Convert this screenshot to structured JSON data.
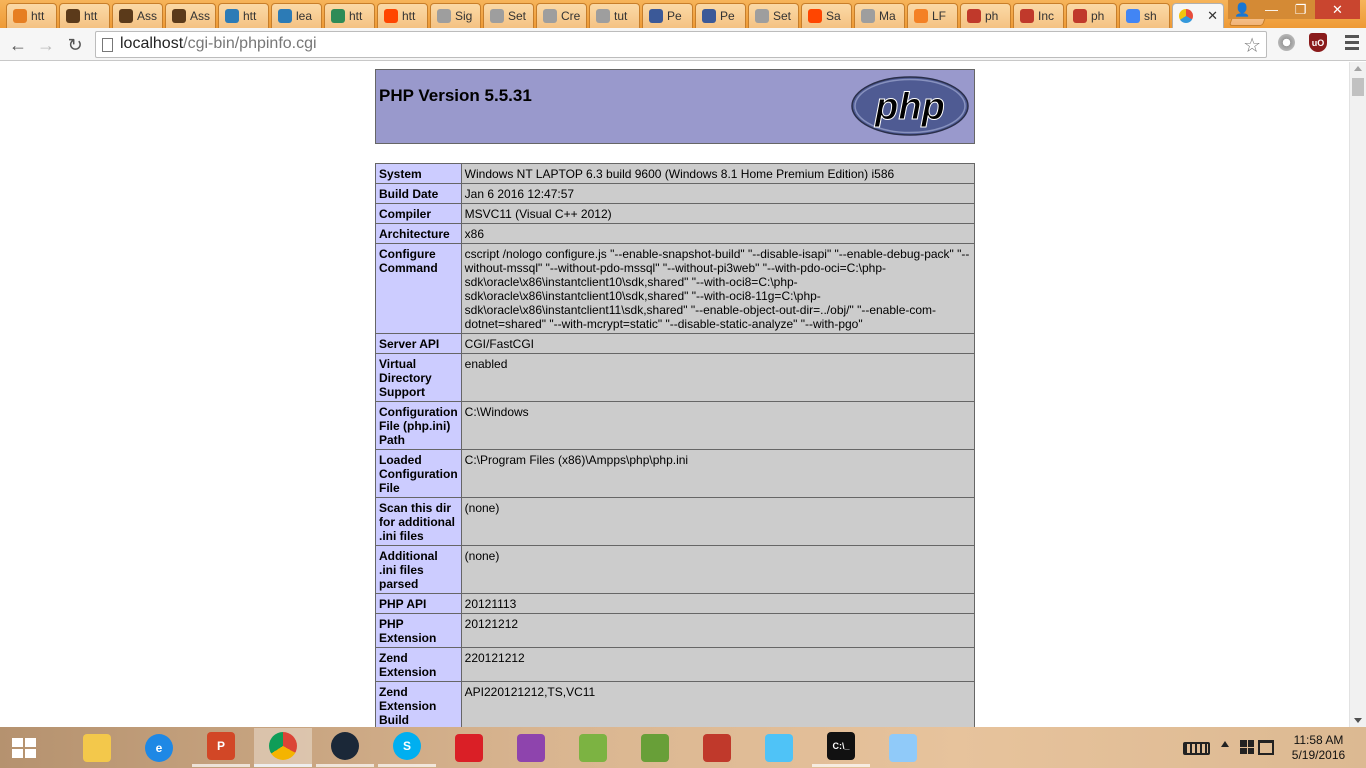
{
  "browser": {
    "tabs": [
      {
        "title": "htt",
        "icon": "orange-circle-icon",
        "color": "#e67e22"
      },
      {
        "title": "htt",
        "icon": "blackboard-icon",
        "color": "#5b3a1a"
      },
      {
        "title": "Ass",
        "icon": "blackboard-icon",
        "color": "#5b3a1a"
      },
      {
        "title": "Ass",
        "icon": "blackboard-icon",
        "color": "#5b3a1a"
      },
      {
        "title": "htt",
        "icon": "pinwheel-icon",
        "color": "#2c7bb6"
      },
      {
        "title": "lea",
        "icon": "pinwheel-icon",
        "color": "#2c7bb6"
      },
      {
        "title": "htt",
        "icon": "arrow-green-icon",
        "color": "#2e8b57"
      },
      {
        "title": "htt",
        "icon": "reddit-icon",
        "color": "#ff4500"
      },
      {
        "title": "Sig",
        "icon": "document-icon",
        "color": "#9e9e9e"
      },
      {
        "title": "Set",
        "icon": "document-icon",
        "color": "#9e9e9e"
      },
      {
        "title": "Cre",
        "icon": "document-icon",
        "color": "#9e9e9e"
      },
      {
        "title": "tut",
        "icon": "document-icon",
        "color": "#9e9e9e"
      },
      {
        "title": "Pe",
        "icon": "shield-blue-icon",
        "color": "#3b5998"
      },
      {
        "title": "Pe",
        "icon": "shield-blue-icon",
        "color": "#3b5998"
      },
      {
        "title": "Set",
        "icon": "document-icon",
        "color": "#9e9e9e"
      },
      {
        "title": "Sa",
        "icon": "reddit-icon",
        "color": "#ff4500"
      },
      {
        "title": "Ma",
        "icon": "document-icon",
        "color": "#9e9e9e"
      },
      {
        "title": "LF",
        "icon": "stack-icon",
        "color": "#f48024"
      },
      {
        "title": "ph",
        "icon": "ampps-icon",
        "color": "#c0392b"
      },
      {
        "title": "Inc",
        "icon": "ampps-icon",
        "color": "#c0392b"
      },
      {
        "title": "ph",
        "icon": "ampps-icon",
        "color": "#c0392b"
      },
      {
        "title": "sh",
        "icon": "google-icon",
        "color": "#4285f4"
      }
    ],
    "active_tab": {
      "icon": "ampps-icon",
      "close_label": "✕"
    },
    "window": {
      "minimize": "—",
      "restore": "❐",
      "close": "✕",
      "user": "👤"
    },
    "url": {
      "host": "localhost",
      "path": "/cgi-bin/phpinfo.cgi"
    },
    "nav": {
      "back": "←",
      "forward": "→",
      "reload": "↻",
      "star": "☆",
      "ublock": "uO"
    }
  },
  "phpinfo": {
    "title": "PHP Version 5.5.31",
    "logo_text": "php",
    "rows": [
      {
        "key": "System",
        "value": "Windows NT LAPTOP 6.3 build 9600 (Windows 8.1 Home Premium Edition) i586"
      },
      {
        "key": "Build Date",
        "value": "Jan 6 2016 12:47:57"
      },
      {
        "key": "Compiler",
        "value": "MSVC11 (Visual C++ 2012)"
      },
      {
        "key": "Architecture",
        "value": "x86"
      },
      {
        "key": "Configure Command",
        "value": "cscript /nologo configure.js \"--enable-snapshot-build\" \"--disable-isapi\" \"--enable-debug-pack\" \"--without-mssql\" \"--without-pdo-mssql\" \"--without-pi3web\" \"--with-pdo-oci=C:\\php-sdk\\oracle\\x86\\instantclient10\\sdk,shared\" \"--with-oci8=C:\\php-sdk\\oracle\\x86\\instantclient10\\sdk,shared\" \"--with-oci8-11g=C:\\php-sdk\\oracle\\x86\\instantclient11\\sdk,shared\" \"--enable-object-out-dir=../obj/\" \"--enable-com-dotnet=shared\" \"--with-mcrypt=static\" \"--disable-static-analyze\" \"--with-pgo\""
      },
      {
        "key": "Server API",
        "value": "CGI/FastCGI"
      },
      {
        "key": "Virtual Directory Support",
        "value": "enabled"
      },
      {
        "key": "Configuration File (php.ini) Path",
        "value": "C:\\Windows"
      },
      {
        "key": "Loaded Configuration File",
        "value": "C:\\Program Files (x86)\\Ampps\\php\\php.ini"
      },
      {
        "key": "Scan this dir for additional .ini files",
        "value": "(none)"
      },
      {
        "key": "Additional .ini files parsed",
        "value": "(none)"
      },
      {
        "key": "PHP API",
        "value": "20121113"
      },
      {
        "key": "PHP Extension",
        "value": "20121212"
      },
      {
        "key": "Zend Extension",
        "value": "220121212"
      },
      {
        "key": "Zend Extension Build",
        "value": "API220121212,TS,VC11"
      }
    ]
  },
  "taskbar": {
    "items": [
      {
        "name": "file-explorer",
        "icon": "folder-icon",
        "color": "#f3c84b",
        "label": "",
        "state": "normal"
      },
      {
        "name": "internet-explorer",
        "icon": "ie-icon",
        "color": "#1e88e5",
        "label": "e",
        "state": "normal"
      },
      {
        "name": "powerpoint",
        "icon": "powerpoint-icon",
        "color": "#d24726",
        "label": "P",
        "state": "running"
      },
      {
        "name": "chrome",
        "icon": "chrome-icon",
        "color": "#4caf50",
        "label": "",
        "state": "active"
      },
      {
        "name": "steam",
        "icon": "steam-icon",
        "color": "#1b2838",
        "label": "",
        "state": "running"
      },
      {
        "name": "skype",
        "icon": "skype-icon",
        "color": "#00aff0",
        "label": "S",
        "state": "running"
      },
      {
        "name": "creative-cloud",
        "icon": "creative-cloud-icon",
        "color": "#da1f26",
        "label": "",
        "state": "normal"
      },
      {
        "name": "git-gui",
        "icon": "git-icon",
        "color": "#8e44ad",
        "label": "",
        "state": "normal"
      },
      {
        "name": "notepad-plus",
        "icon": "notepad-icon",
        "color": "#7cb342",
        "label": "",
        "state": "normal"
      },
      {
        "name": "android-studio",
        "icon": "android-icon",
        "color": "#689f38",
        "label": "",
        "state": "normal"
      },
      {
        "name": "ampps",
        "icon": "ampps-icon",
        "color": "#c0392b",
        "label": "",
        "state": "normal"
      },
      {
        "name": "notes",
        "icon": "notes-icon",
        "color": "#4fc3f7",
        "label": "",
        "state": "normal"
      },
      {
        "name": "command-prompt",
        "icon": "terminal-icon",
        "color": "#111111",
        "label": "C:\\_",
        "state": "running"
      },
      {
        "name": "paint",
        "icon": "paint-icon",
        "color": "#90caf9",
        "label": "",
        "state": "normal"
      }
    ],
    "clock": {
      "time": "11:58 AM",
      "date": "5/19/2016"
    }
  },
  "colors": {
    "header_bg": "#9999cc",
    "key_bg": "#ccccff",
    "value_bg": "#cccccc",
    "tabstrip": "#ee9a36"
  }
}
